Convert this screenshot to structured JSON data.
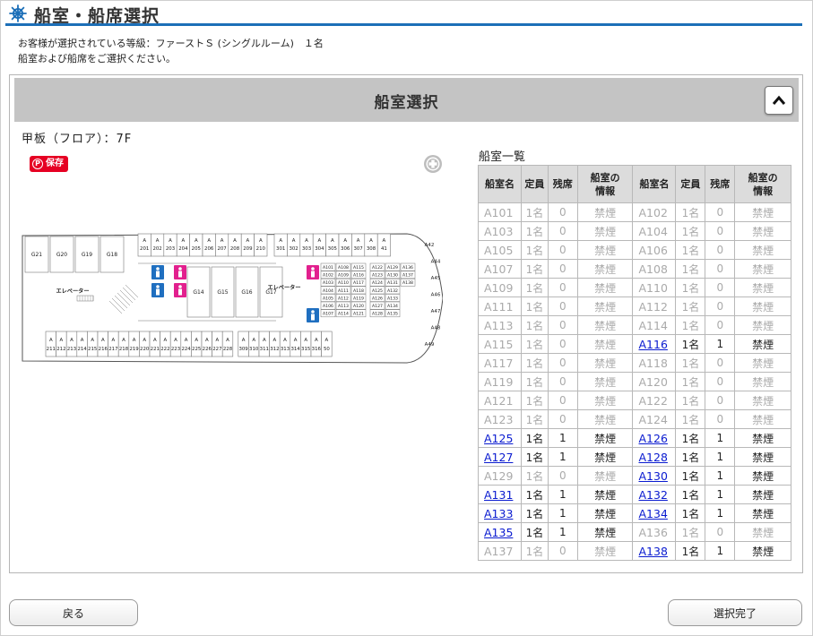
{
  "header": {
    "title": "船室・船席選択",
    "icon": "ship-wheel-icon"
  },
  "intro": {
    "line1": "お客様が選択されている等級：ファーストＳ (シングルルーム)　１名",
    "line2": "船室および船席をご選択ください。"
  },
  "panel": {
    "title": "船室選択",
    "collapse_icon": "chevron-up-icon",
    "deck_label": "甲板（フロア）：7F",
    "pin_label": "保存",
    "zoom_icon": "plus-circle-icon",
    "list_label": "船室一覧"
  },
  "table": {
    "headers": [
      "船室名",
      "定員",
      "残席",
      "船室の\n情報",
      "船室名",
      "定員",
      "残席",
      "船室の\n情報"
    ],
    "rows": [
      [
        {
          "name": "A101",
          "cap": "1名",
          "left": "0",
          "info": "禁煙",
          "avail": false
        },
        {
          "name": "A102",
          "cap": "1名",
          "left": "0",
          "info": "禁煙",
          "avail": false
        }
      ],
      [
        {
          "name": "A103",
          "cap": "1名",
          "left": "0",
          "info": "禁煙",
          "avail": false
        },
        {
          "name": "A104",
          "cap": "1名",
          "left": "0",
          "info": "禁煙",
          "avail": false
        }
      ],
      [
        {
          "name": "A105",
          "cap": "1名",
          "left": "0",
          "info": "禁煙",
          "avail": false
        },
        {
          "name": "A106",
          "cap": "1名",
          "left": "0",
          "info": "禁煙",
          "avail": false
        }
      ],
      [
        {
          "name": "A107",
          "cap": "1名",
          "left": "0",
          "info": "禁煙",
          "avail": false
        },
        {
          "name": "A108",
          "cap": "1名",
          "left": "0",
          "info": "禁煙",
          "avail": false
        }
      ],
      [
        {
          "name": "A109",
          "cap": "1名",
          "left": "0",
          "info": "禁煙",
          "avail": false
        },
        {
          "name": "A110",
          "cap": "1名",
          "left": "0",
          "info": "禁煙",
          "avail": false
        }
      ],
      [
        {
          "name": "A111",
          "cap": "1名",
          "left": "0",
          "info": "禁煙",
          "avail": false
        },
        {
          "name": "A112",
          "cap": "1名",
          "left": "0",
          "info": "禁煙",
          "avail": false
        }
      ],
      [
        {
          "name": "A113",
          "cap": "1名",
          "left": "0",
          "info": "禁煙",
          "avail": false
        },
        {
          "name": "A114",
          "cap": "1名",
          "left": "0",
          "info": "禁煙",
          "avail": false
        }
      ],
      [
        {
          "name": "A115",
          "cap": "1名",
          "left": "0",
          "info": "禁煙",
          "avail": false
        },
        {
          "name": "A116",
          "cap": "1名",
          "left": "1",
          "info": "禁煙",
          "avail": true
        }
      ],
      [
        {
          "name": "A117",
          "cap": "1名",
          "left": "0",
          "info": "禁煙",
          "avail": false
        },
        {
          "name": "A118",
          "cap": "1名",
          "left": "0",
          "info": "禁煙",
          "avail": false
        }
      ],
      [
        {
          "name": "A119",
          "cap": "1名",
          "left": "0",
          "info": "禁煙",
          "avail": false
        },
        {
          "name": "A120",
          "cap": "1名",
          "left": "0",
          "info": "禁煙",
          "avail": false
        }
      ],
      [
        {
          "name": "A121",
          "cap": "1名",
          "left": "0",
          "info": "禁煙",
          "avail": false
        },
        {
          "name": "A122",
          "cap": "1名",
          "left": "0",
          "info": "禁煙",
          "avail": false
        }
      ],
      [
        {
          "name": "A123",
          "cap": "1名",
          "left": "0",
          "info": "禁煙",
          "avail": false
        },
        {
          "name": "A124",
          "cap": "1名",
          "left": "0",
          "info": "禁煙",
          "avail": false
        }
      ],
      [
        {
          "name": "A125",
          "cap": "1名",
          "left": "1",
          "info": "禁煙",
          "avail": true
        },
        {
          "name": "A126",
          "cap": "1名",
          "left": "1",
          "info": "禁煙",
          "avail": true
        }
      ],
      [
        {
          "name": "A127",
          "cap": "1名",
          "left": "1",
          "info": "禁煙",
          "avail": true
        },
        {
          "name": "A128",
          "cap": "1名",
          "left": "1",
          "info": "禁煙",
          "avail": true
        }
      ],
      [
        {
          "name": "A129",
          "cap": "1名",
          "left": "0",
          "info": "禁煙",
          "avail": false
        },
        {
          "name": "A130",
          "cap": "1名",
          "left": "1",
          "info": "禁煙",
          "avail": true
        }
      ],
      [
        {
          "name": "A131",
          "cap": "1名",
          "left": "1",
          "info": "禁煙",
          "avail": true
        },
        {
          "name": "A132",
          "cap": "1名",
          "left": "1",
          "info": "禁煙",
          "avail": true
        }
      ],
      [
        {
          "name": "A133",
          "cap": "1名",
          "left": "1",
          "info": "禁煙",
          "avail": true
        },
        {
          "name": "A134",
          "cap": "1名",
          "left": "1",
          "info": "禁煙",
          "avail": true
        }
      ],
      [
        {
          "name": "A135",
          "cap": "1名",
          "left": "1",
          "info": "禁煙",
          "avail": true
        },
        {
          "name": "A136",
          "cap": "1名",
          "left": "0",
          "info": "禁煙",
          "avail": false
        }
      ],
      [
        {
          "name": "A137",
          "cap": "1名",
          "left": "0",
          "info": "禁煙",
          "avail": false
        },
        {
          "name": "A138",
          "cap": "1名",
          "left": "1",
          "info": "禁煙",
          "avail": true
        }
      ]
    ]
  },
  "deck_map": {
    "top_rooms": [
      "201",
      "202",
      "203",
      "204",
      "205",
      "206",
      "207",
      "208",
      "209",
      "210",
      "301",
      "302",
      "303",
      "304",
      "305",
      "306",
      "307",
      "308",
      "41"
    ],
    "bottom_rooms": [
      "211",
      "212",
      "213",
      "214",
      "215",
      "216",
      "217",
      "218",
      "219",
      "220",
      "221",
      "222",
      "223",
      "224",
      "225",
      "226",
      "227",
      "228",
      "309",
      "310",
      "311",
      "312",
      "313",
      "314",
      "315",
      "316",
      "50"
    ],
    "room_prefix": "A",
    "left_rooms": [
      "G21",
      "G20",
      "G19",
      "G18"
    ],
    "mid_rooms": [
      "G14",
      "G15",
      "G16",
      "G17"
    ],
    "right_rooms": [
      "A42",
      "A44",
      "A45",
      "A46",
      "A47",
      "A48",
      "A49"
    ],
    "elevator_label": "エレベーター",
    "cabin_grid_cols": [
      [
        "A101",
        "A102",
        "A103",
        "A104",
        "A105",
        "A106",
        "A107"
      ],
      [
        "A108",
        "A109",
        "A110",
        "A111",
        "A112",
        "A113",
        "A114"
      ],
      [
        "A115",
        "A116",
        "A117",
        "A118",
        "A119",
        "A120",
        "A121"
      ],
      [
        "A122",
        "A123",
        "A124",
        "A125",
        "A126",
        "A127",
        "A128"
      ],
      [
        "A129",
        "A130",
        "A131",
        "A132",
        "A133",
        "A134",
        "A135"
      ],
      [
        "A136",
        "A137",
        "A138"
      ]
    ],
    "colors": {
      "wc_male": "#1f6fc0",
      "wc_female": "#e2208e"
    }
  },
  "buttons": {
    "back": "戻る",
    "done": "選択完了"
  }
}
